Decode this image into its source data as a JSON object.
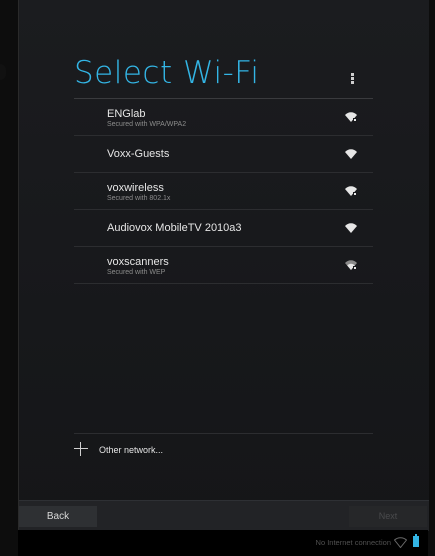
{
  "setup": {
    "title": "Select Wi-Fi",
    "overflow_icon": "overflow-menu-icon"
  },
  "networks": [
    {
      "name": "ENGlab",
      "security": "Secured with WPA/WPA2",
      "icon": "wifi-secured-icon"
    },
    {
      "name": "Voxx-Guests",
      "security": "",
      "icon": "wifi-open-icon"
    },
    {
      "name": "voxwireless",
      "security": "Secured with 802.1x",
      "icon": "wifi-secured-icon"
    },
    {
      "name": "Audiovox MobileTV 2010a3",
      "security": "",
      "icon": "wifi-open-icon"
    },
    {
      "name": "voxscanners",
      "security": "Secured with WEP",
      "icon": "wifi-secured-weak-icon"
    }
  ],
  "other_network": {
    "label": "Other network...",
    "icon": "plus-icon"
  },
  "nav": {
    "back_label": "Back",
    "next_label": "Next"
  },
  "status_bar": {
    "connection_text": "No Internet connection",
    "accent": "#33b5e5"
  }
}
